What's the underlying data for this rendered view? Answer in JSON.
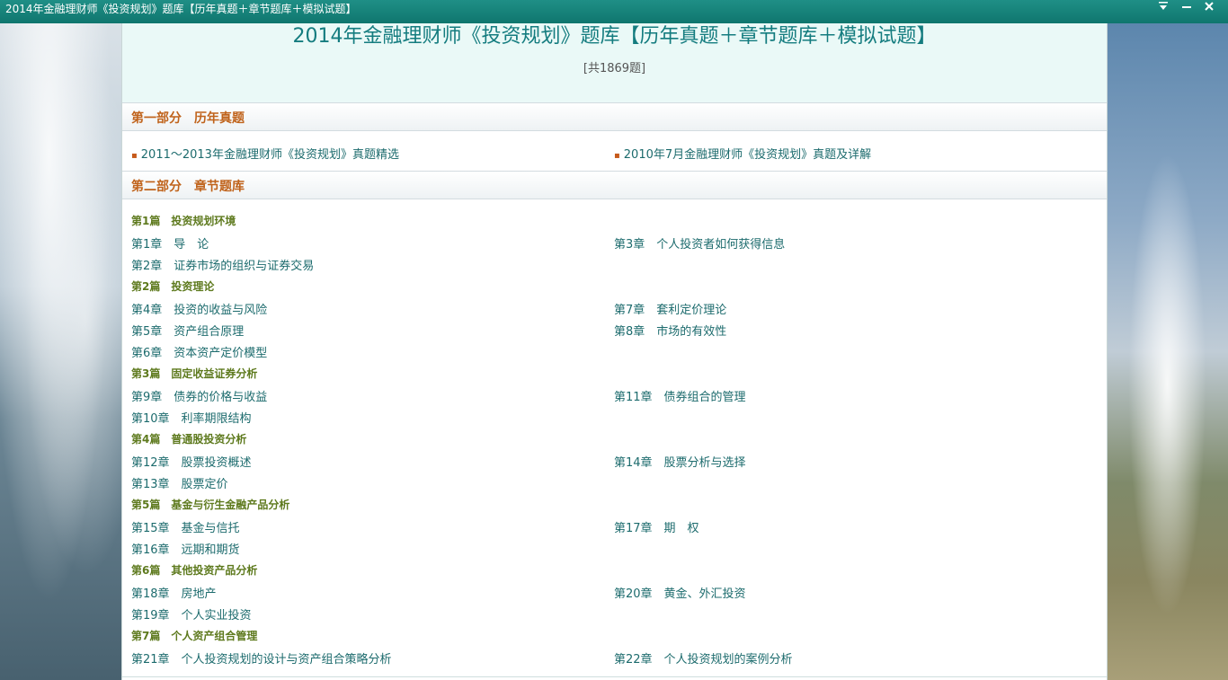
{
  "window": {
    "title": "2014年金融理财师《投资规划》题库【历年真题＋章节题库＋模拟试题】",
    "controls": [
      "dropdown-icon",
      "minimize-icon",
      "close-icon"
    ]
  },
  "header": {
    "title": "2014年金融理财师《投资规划》题库【历年真题＋章节题库＋模拟试题】",
    "count": "[共1869题]"
  },
  "part1": {
    "heading": "第一部分　历年真题",
    "links": [
      "2011～2013年金融理财师《投资规划》真题精选",
      "2010年7月金融理财师《投资规划》真题及详解"
    ]
  },
  "part2": {
    "heading": "第二部分　章节题库",
    "groups": [
      {
        "title": "第1篇　投资规划环境",
        "left": [
          "第1章　导　论",
          "第2章　证券市场的组织与证券交易"
        ],
        "right": [
          "第3章　个人投资者如何获得信息"
        ]
      },
      {
        "title": "第2篇　投资理论",
        "left": [
          "第4章　投资的收益与风险",
          "第5章　资产组合原理",
          "第6章　资本资产定价模型"
        ],
        "right": [
          "第7章　套利定价理论",
          "第8章　市场的有效性"
        ]
      },
      {
        "title": "第3篇　固定收益证券分析",
        "left": [
          "第9章　债券的价格与收益",
          "第10章　利率期限结构"
        ],
        "right": [
          "第11章　债券组合的管理"
        ]
      },
      {
        "title": "第4篇　普通股投资分析",
        "left": [
          "第12章　股票投资概述",
          "第13章　股票定价"
        ],
        "right": [
          "第14章　股票分析与选择"
        ]
      },
      {
        "title": "第5篇　基金与衍生金融产品分析",
        "left": [
          "第15章　基金与信托",
          "第16章　远期和期货"
        ],
        "right": [
          "第17章　期　权"
        ]
      },
      {
        "title": "第6篇　其他投资产品分析",
        "left": [
          "第18章　房地产",
          "第19章　个人实业投资"
        ],
        "right": [
          "第20章　黄金、外汇投资"
        ]
      },
      {
        "title": "第7篇　个人资产组合管理",
        "left": [
          "第21章　个人投资规划的设计与资产组合策略分析"
        ],
        "right": [
          "第22章　个人投资规划的案例分析"
        ]
      }
    ]
  }
}
